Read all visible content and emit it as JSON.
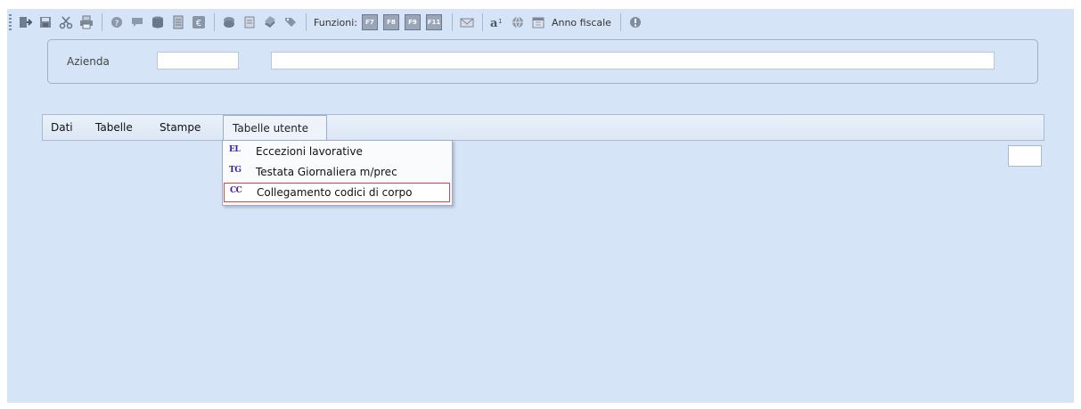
{
  "toolbar": {
    "functions_label": "Funzioni:",
    "fkeys": [
      "F7",
      "F8",
      "F9",
      "F11"
    ],
    "fiscal_year_label": "Anno fiscale"
  },
  "azienda": {
    "label": "Azienda",
    "code_value": "",
    "description_value": ""
  },
  "menubar": {
    "items": [
      {
        "label": "Dati"
      },
      {
        "label": "Tabelle"
      },
      {
        "label": "Stampe"
      },
      {
        "label": "Tabelle utente"
      }
    ]
  },
  "dropdown": {
    "items": [
      {
        "badge": "EL",
        "label": "Eccezioni lavorative"
      },
      {
        "badge": "TG",
        "label": "Testata Giornaliera m/prec"
      },
      {
        "badge": "CC",
        "label": "Collegamento codici di corpo"
      }
    ]
  },
  "colors": {
    "background": "#d6e4f7",
    "selection_border": "#d9443d",
    "badge": "#3a1b9c"
  }
}
